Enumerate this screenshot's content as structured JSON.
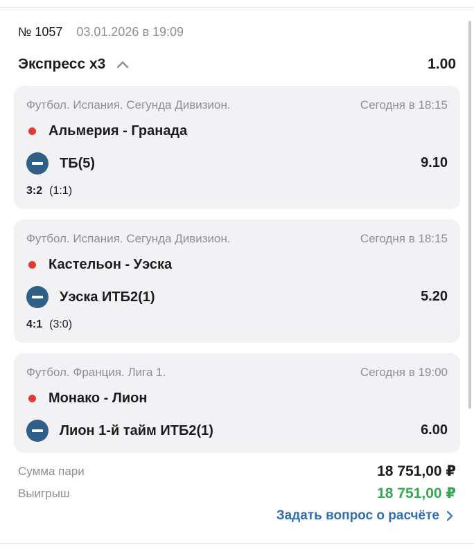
{
  "header": {
    "bet_number": "№ 1057",
    "bet_date": "03.01.2026 в 19:09"
  },
  "express": {
    "title": "Экспресс x3",
    "total_odds": "1.00",
    "toggle_icon": "chevron-up-icon"
  },
  "events": [
    {
      "league": "Футбол. Испания. Сегунда Дивизион.",
      "time": "Сегодня в 18:15",
      "match": "Альмерия - Гранада",
      "pick": "ТБ(5)",
      "odds": "9.10",
      "score": "3:2",
      "half_score": "(1:1)",
      "status_icon": "minus-icon"
    },
    {
      "league": "Футбол. Испания. Сегунда Дивизион.",
      "time": "Сегодня в 18:15",
      "match": "Кастельон - Уэска",
      "pick": "Уэска ИТБ2(1)",
      "odds": "5.20",
      "score": "4:1",
      "half_score": "(3:0)",
      "status_icon": "minus-icon"
    },
    {
      "league": "Футбол. Франция. Лига 1.",
      "time": "Сегодня в 19:00",
      "match": "Монако - Лион",
      "pick": "Лион 1-й тайм ИТБ2(1)",
      "odds": "6.00",
      "status_icon": "minus-icon"
    }
  ],
  "summary": {
    "stake_label": "Сумма пари",
    "stake_value": "18 751,00 ₽",
    "win_label": "Выигрыш",
    "win_value": "18 751,00 ₽",
    "ask_link": "Задать вопрос о расчёте"
  },
  "colors": {
    "live_dot": "#e53935",
    "lost_icon": "#2f5f86",
    "win_amount": "#34a853",
    "link": "#2f6db5",
    "card_bg": "#f2f2f4"
  }
}
